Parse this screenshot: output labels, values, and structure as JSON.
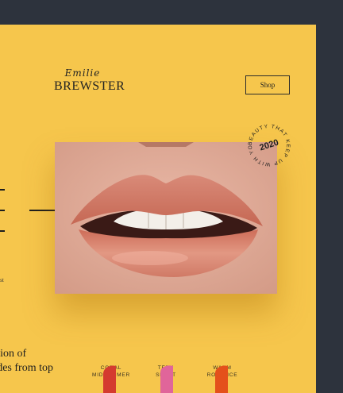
{
  "brand": {
    "script": "Emilie",
    "name": "BREWSTER"
  },
  "nav": {
    "shop_label": "Shop"
  },
  "stamp": {
    "arc_text": "BEAUTY THAT KEEP UP WITH YOU",
    "year": "2020"
  },
  "hero": {
    "image": "lips-closeup-photo"
  },
  "left_edge": {
    "glyph": "E",
    "note": "st"
  },
  "headline": {
    "line1": "ction of",
    "line2": "ades from top"
  },
  "products": [
    {
      "line1": "CORAL",
      "line2": "MIDSUMMER",
      "color": "#d43b2f"
    },
    {
      "line1": "TEEN",
      "line2": "SPIRIT",
      "color": "#e0659a"
    },
    {
      "line1": "WARM",
      "line2": "ROMANCE",
      "color": "#e4501b"
    }
  ],
  "colors": {
    "page_bg": "#f6c64c",
    "frame": "#2d333d",
    "text": "#1e1e1e"
  }
}
